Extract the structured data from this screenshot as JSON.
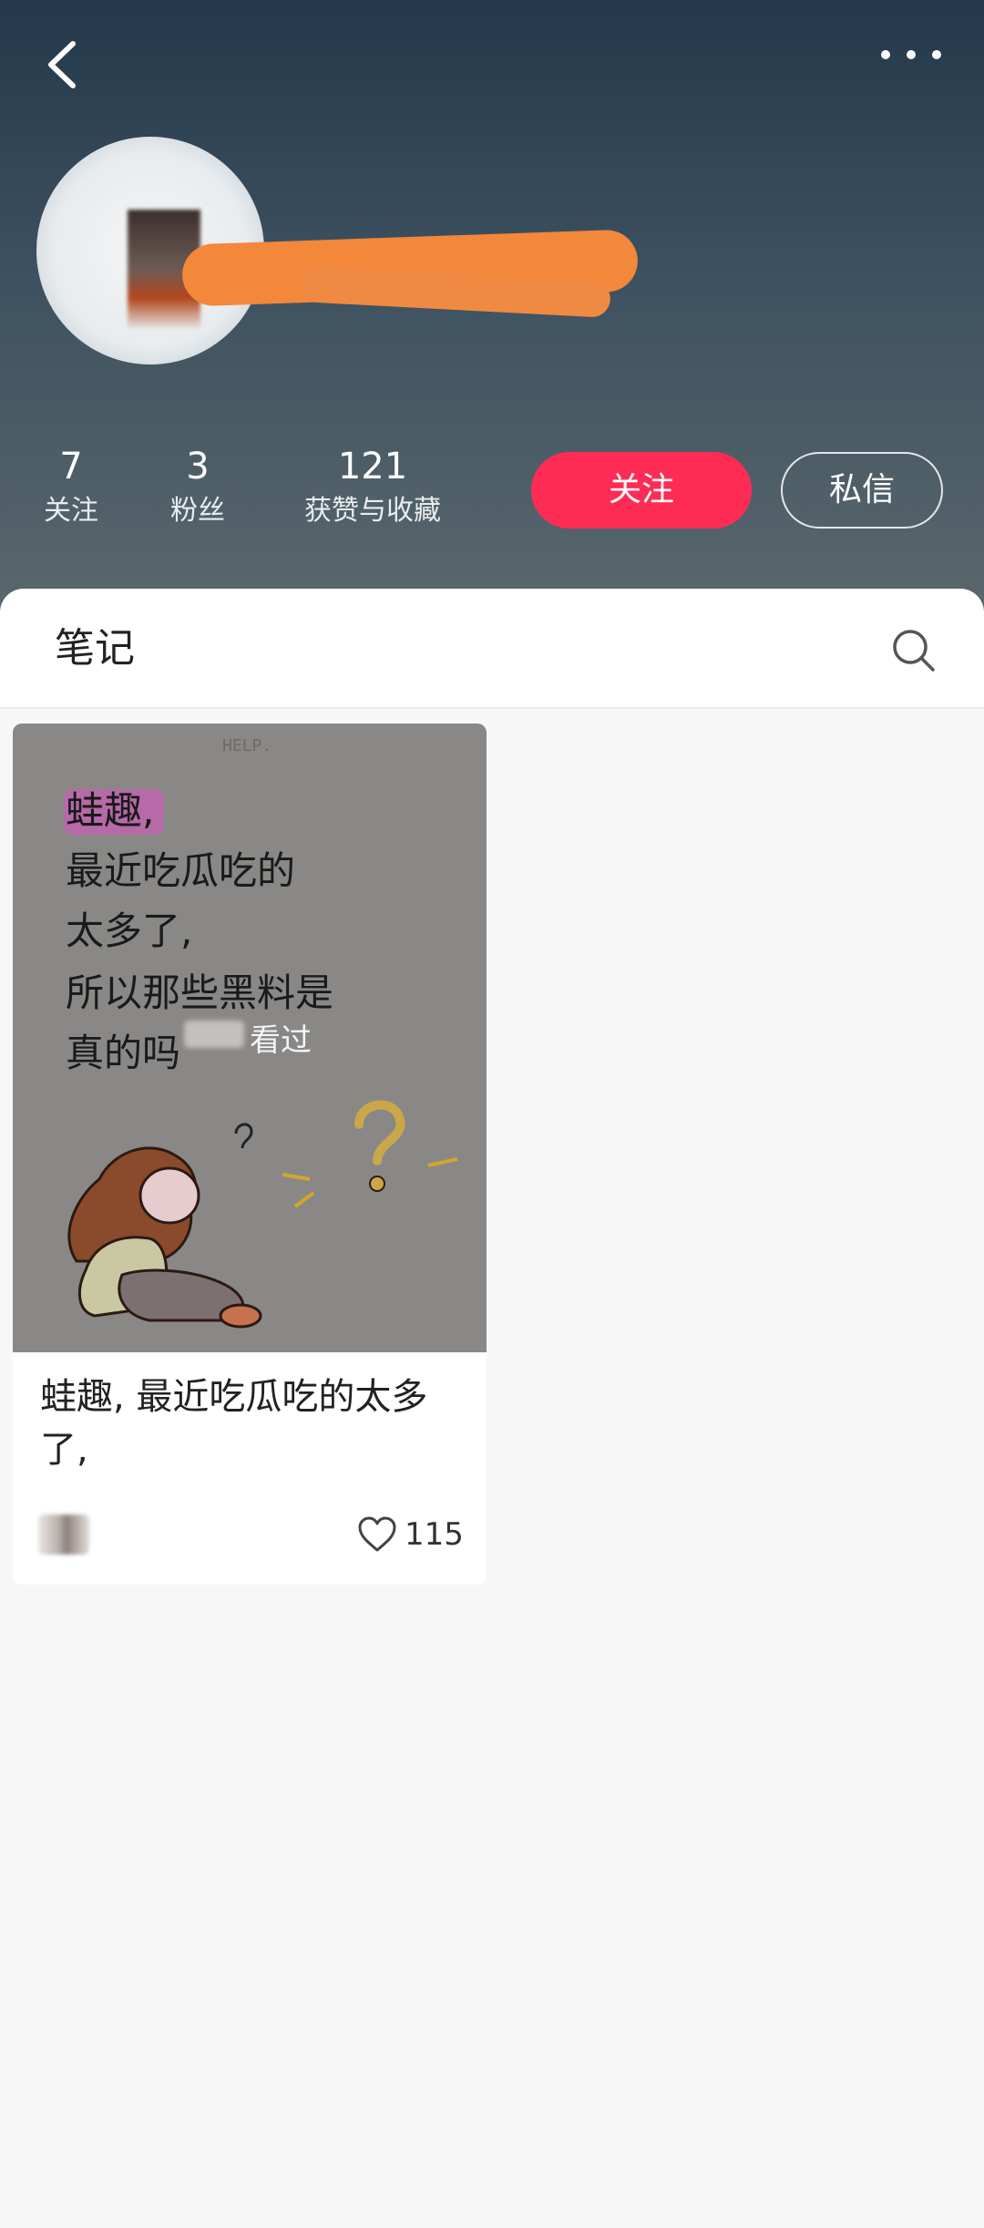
{
  "header": {
    "back_icon": "chevron-left-icon",
    "more_icon": "more-dots-icon",
    "stats": [
      {
        "value": "7",
        "label": "关注"
      },
      {
        "value": "3",
        "label": "粉丝"
      },
      {
        "value": "121",
        "label": "获赞与收藏"
      }
    ],
    "follow_label": "关注",
    "message_label": "私信"
  },
  "tabs": {
    "notes_label": "笔记",
    "search_icon": "search-icon"
  },
  "note": {
    "cover_text_lines": [
      "蛙趣,",
      "最近吃瓜吃的",
      "太多了,",
      "所以那些黑料是",
      "真的吗"
    ],
    "cover_small_text": "HELP.",
    "viewed_label": "看过",
    "title": "蛙趣, 最近吃瓜吃的太多了,",
    "like_count": "115"
  },
  "colors": {
    "accent": "#fe2c55",
    "redaction": "#f3873a",
    "highlight": "#b66aa8"
  }
}
